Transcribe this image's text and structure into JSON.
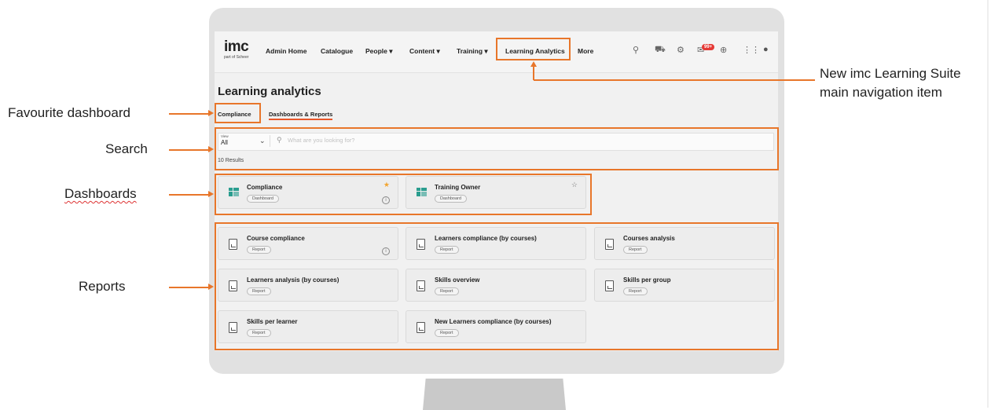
{
  "logo": {
    "main": "imc",
    "sub": "part of Scheer"
  },
  "nav": {
    "admin_home": "Admin Home",
    "catalogue": "Catalogue",
    "people": "People ▾",
    "content": "Content ▾",
    "training": "Training ▾",
    "learning_analytics": "Learning Analytics",
    "more": "More",
    "badge": "99+"
  },
  "page": {
    "title": "Learning analytics"
  },
  "tabs": {
    "compliance": "Compliance",
    "dashboards_reports": "Dashboards & Reports"
  },
  "search": {
    "view_label": "View",
    "view_value": "All",
    "placeholder": "What are you looking for?",
    "results": "10 Results"
  },
  "dashboards": [
    {
      "title": "Compliance",
      "tag": "Dashboard"
    },
    {
      "title": "Training Owner",
      "tag": "Dashboard"
    }
  ],
  "reports": [
    {
      "title": "Course compliance",
      "tag": "Report"
    },
    {
      "title": "Learners compliance (by courses)",
      "tag": "Report"
    },
    {
      "title": "Courses analysis",
      "tag": "Report"
    },
    {
      "title": "Learners analysis (by courses)",
      "tag": "Report"
    },
    {
      "title": "Skills overview",
      "tag": "Report"
    },
    {
      "title": "Skills per group",
      "tag": "Report"
    },
    {
      "title": "Skills per learner",
      "tag": "Report"
    },
    {
      "title": "New Learners compliance (by courses)",
      "tag": "Report"
    }
  ],
  "annotations": {
    "favourite": "Favourite dashboard",
    "search": "Search",
    "dashboards": "Dashboards",
    "reports": "Reports",
    "nav_line1": "New imc Learning Suite",
    "nav_line2": "main navigation item"
  },
  "colors": {
    "accent": "#e8762a",
    "active_tab": "#e8562a",
    "star_filled": "#f2a531",
    "dashboard_icon": "#2a9d8f",
    "badge": "#e53935"
  },
  "icons": [
    "search-icon",
    "cart-icon",
    "gear-icon",
    "mail-icon",
    "globe-icon",
    "apps-grid-icon",
    "avatar"
  ]
}
